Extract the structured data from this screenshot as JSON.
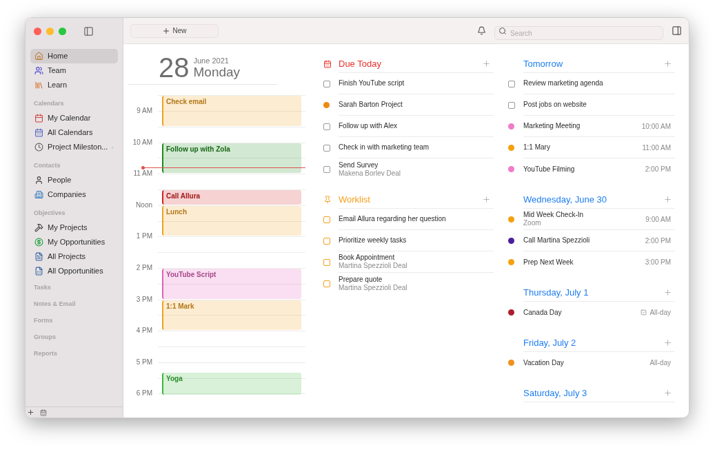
{
  "toolbar": {
    "new_button": "New",
    "search": {
      "placeholder": "Search"
    }
  },
  "sidebar": {
    "items": [
      {
        "label": "Home",
        "selected": true
      },
      {
        "label": "Team",
        "selected": false
      },
      {
        "label": "Learn",
        "selected": false
      }
    ],
    "sections": [
      {
        "title": "Calendars",
        "items": [
          {
            "label": "My Calendar",
            "selected": false
          },
          {
            "label": "All Calendars",
            "selected": false
          },
          {
            "label": "Project Mileston...",
            "selected": false,
            "shared": true
          }
        ]
      },
      {
        "title": "Contacts",
        "items": [
          {
            "label": "People",
            "selected": false
          },
          {
            "label": "Companies",
            "selected": false
          }
        ]
      },
      {
        "title": "Objectives",
        "items": [
          {
            "label": "My Projects",
            "selected": false
          },
          {
            "label": "My Opportunities",
            "selected": false
          },
          {
            "label": "All Projects",
            "selected": false
          },
          {
            "label": "All Opportunities",
            "selected": false
          }
        ]
      },
      {
        "title": "Tasks"
      },
      {
        "title": "Notes & Email"
      },
      {
        "title": "Forms"
      },
      {
        "title": "Groups"
      },
      {
        "title": "Reports"
      }
    ]
  },
  "day": {
    "number": "28",
    "month": "June 2021",
    "weekday": "Monday",
    "hours": [
      "9 AM",
      "10 AM",
      "11 AM",
      "Noon",
      "1 PM",
      "2 PM",
      "3 PM",
      "4 PM",
      "5 PM",
      "6 PM"
    ],
    "events": [
      {
        "title": "Check email",
        "color": "#f0a020"
      },
      {
        "title": "Follow up with Zola",
        "color": "#1e8a1e"
      },
      {
        "title": "Call Allura",
        "color": "#d42020"
      },
      {
        "title": "Lunch",
        "color": "#f0a020"
      },
      {
        "title": "YouTube Script",
        "color": "#e060b8"
      },
      {
        "title": "1:1 Mark",
        "color": "#f0a020"
      },
      {
        "title": "Yoga",
        "color": "#3cb83c"
      }
    ]
  },
  "lists": [
    {
      "title": "Due Today",
      "kind": "due",
      "color": "#e8302c",
      "items": [
        {
          "kind": "task",
          "title": "Finish YouTube script",
          "checked": false
        },
        {
          "kind": "event",
          "title": "Sarah Barton Project",
          "color": "#ee8a12"
        },
        {
          "kind": "task",
          "title": "Follow up with Alex",
          "checked": false
        },
        {
          "kind": "task",
          "title": "Check in with marketing team",
          "checked": false
        },
        {
          "kind": "task",
          "title": "Send Survey",
          "subtitle": "Makena Borlev Deal",
          "checked": false
        }
      ]
    },
    {
      "title": "Worklist",
      "kind": "worklist",
      "color": "#f5a01c",
      "items": [
        {
          "kind": "task",
          "title": "Email Allura regarding her question",
          "checked": false
        },
        {
          "kind": "task",
          "title": "Prioritize weekly tasks",
          "checked": false
        },
        {
          "kind": "task",
          "title": "Book Appointment",
          "subtitle": "Martina Spezzioli Deal",
          "checked": false
        },
        {
          "kind": "task",
          "title": "Prepare quote",
          "subtitle": "Martina Spezzioli Deal",
          "checked": false
        }
      ]
    }
  ],
  "agenda": [
    {
      "title": "Tomorrow",
      "color": "#1e7ef0",
      "items": [
        {
          "kind": "task",
          "title": "Review marketing agenda",
          "checked": false
        },
        {
          "kind": "task",
          "title": "Post jobs on website",
          "checked": false
        },
        {
          "kind": "event",
          "title": "Marketing Meeting",
          "color": "#f07cc8",
          "time": "10:00 AM"
        },
        {
          "kind": "event",
          "title": "1:1 Mary",
          "color": "#f5a00c",
          "time": "11:00 AM"
        },
        {
          "kind": "event",
          "title": "YouTube Filming",
          "color": "#f07cc8",
          "time": "2:00 PM"
        }
      ]
    },
    {
      "title": "Wednesday, June 30",
      "color": "#1e7ef0",
      "items": [
        {
          "kind": "event",
          "title": "Mid Week Check-In",
          "subtitle": "Zoom",
          "color": "#f5a00c",
          "time": "9:00 AM"
        },
        {
          "kind": "event",
          "title": "Call Martina Spezzioli",
          "color": "#4a1e9a",
          "time": "2:00 PM"
        },
        {
          "kind": "event",
          "title": "Prep Next Week",
          "color": "#f5a00c",
          "time": "3:00 PM"
        }
      ]
    },
    {
      "title": "Thursday, July 1",
      "color": "#1e7ef0",
      "items": [
        {
          "kind": "event",
          "title": "Canada Day",
          "color": "#b01c2c",
          "time": "All-day",
          "all_day_icon": true
        }
      ]
    },
    {
      "title": "Friday, July 2",
      "color": "#1e7ef0",
      "items": [
        {
          "kind": "event",
          "title": "Vacation Day",
          "color": "#f0901a",
          "time": "All-day"
        }
      ]
    },
    {
      "title": "Saturday, July 3",
      "color": "#1e7ef0"
    }
  ]
}
